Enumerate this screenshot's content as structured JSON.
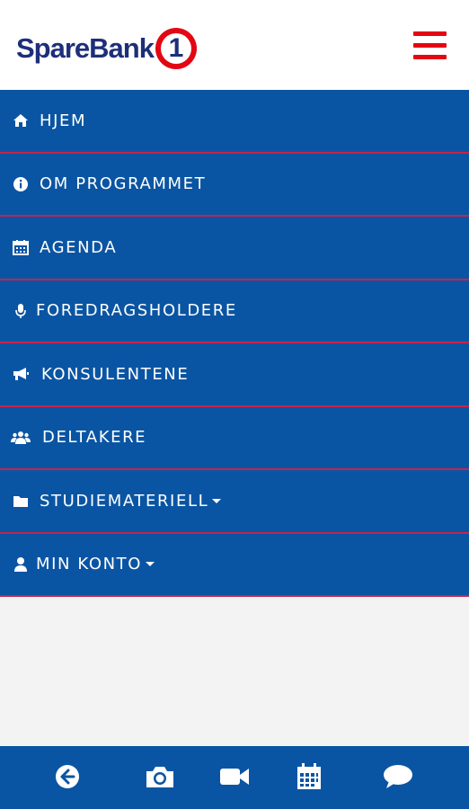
{
  "brand": {
    "name": "SpareBank",
    "badge": "1",
    "primary_color": "#1d2f7a",
    "accent_color": "#e30613",
    "menu_color": "#0a55a3",
    "divider_color": "#c8234a"
  },
  "header": {
    "menu_icon": "hamburger-icon"
  },
  "menu": {
    "items": [
      {
        "label": "HJEM",
        "icon": "home-icon"
      },
      {
        "label": "OM PROGRAMMET",
        "icon": "info-icon"
      },
      {
        "label": "AGENDA",
        "icon": "calendar-icon"
      },
      {
        "label": "FOREDRAGSHOLDERE",
        "icon": "microphone-icon"
      },
      {
        "label": "KONSULENTENE",
        "icon": "megaphone-icon"
      },
      {
        "label": "DELTAKERE",
        "icon": "users-icon"
      },
      {
        "label": "STUDIEMATERIELL",
        "icon": "folder-icon",
        "dropdown": true
      },
      {
        "label": "MIN KONTO",
        "icon": "user-icon",
        "dropdown": true
      }
    ]
  },
  "bottom_bar": {
    "icons": [
      "back-arrow-icon",
      "camera-icon",
      "video-icon",
      "calendar-icon",
      "chat-icon"
    ]
  }
}
